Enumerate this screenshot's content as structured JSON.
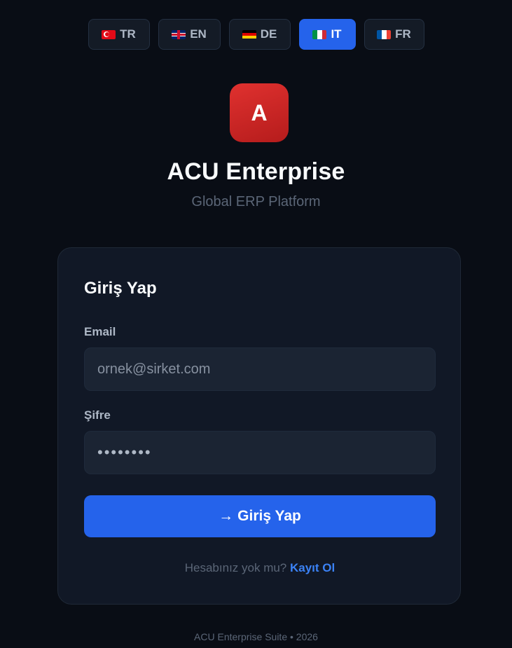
{
  "languages": [
    {
      "code": "TR",
      "flag": "flag-tr",
      "active": false
    },
    {
      "code": "EN",
      "flag": "flag-en",
      "active": false
    },
    {
      "code": "DE",
      "flag": "flag-de",
      "active": false
    },
    {
      "code": "IT",
      "flag": "flag-it",
      "active": true
    },
    {
      "code": "FR",
      "flag": "flag-fr",
      "active": false
    }
  ],
  "brand": {
    "logo_letter": "A",
    "title": "ACU Enterprise",
    "subtitle": "Global ERP Platform",
    "logo_color": "#d42a28"
  },
  "login": {
    "title": "Giriş Yap",
    "email_label": "Email",
    "email_placeholder": "ornek@sirket.com",
    "password_label": "Şifre",
    "password_value": "••••••••",
    "submit_arrow": "→",
    "submit_label": "Giriş Yap",
    "register_prompt": "Hesabınız yok mu?",
    "register_link": "Kayıt Ol"
  },
  "footer": {
    "text": "ACU Enterprise Suite • 2026"
  },
  "colors": {
    "background": "#090d15",
    "card": "#111826",
    "accent": "#2563eb",
    "link": "#3b82f6"
  }
}
